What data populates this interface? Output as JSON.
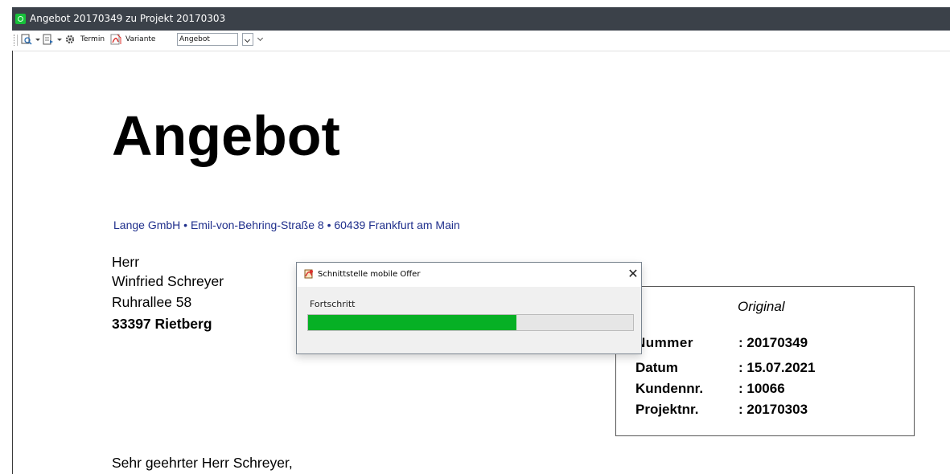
{
  "window": {
    "title": "Angebot 20170349 zu Projekt 20170303"
  },
  "toolbar": {
    "termin_label": "Termin",
    "variante_label": "Variante",
    "variante_value": "Angebot"
  },
  "document": {
    "heading": "Angebot",
    "sender_line": "Lange GmbH • Emil-von-Behring-Straße 8 • 60439 Frankfurt am Main",
    "recipient": {
      "salutation_line": "Herr",
      "name": "Winfried Schreyer",
      "street": "Ruhrallee 58",
      "city": "33397 Rietberg"
    },
    "info": {
      "copy_type": "Original",
      "rows": [
        {
          "label": "Nummer",
          "value": ": 20170349"
        },
        {
          "label": "Datum",
          "value": ": 15.07.2021"
        },
        {
          "label": "Kundennr.",
          "value": ": 10066"
        },
        {
          "label": "Projektnr.",
          "value": ": 20170303"
        }
      ]
    },
    "greeting": "Sehr geehrter Herr Schreyer,"
  },
  "dialog": {
    "title": "Schnittstelle mobile Offer",
    "close_symbol": "✕",
    "progress_label": "Fortschritt",
    "progress_fraction": 0.64,
    "progress_color": "#06b025"
  },
  "colors": {
    "titlebar": "#3b4149",
    "sender_text": "#1f2f8c",
    "app_icon": "#17c13a"
  }
}
